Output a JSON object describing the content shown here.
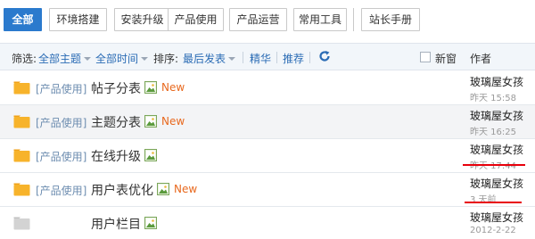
{
  "tabs": [
    {
      "label": "全部",
      "active": true
    },
    {
      "label": "环境搭建",
      "active": false
    },
    {
      "label": "安装升级",
      "active": false
    },
    {
      "label": "产品使用",
      "active": false
    },
    {
      "label": "产品运营",
      "active": false
    },
    {
      "label": "常用工具",
      "active": false
    },
    {
      "label": "站长手册",
      "active": false
    }
  ],
  "filter": {
    "filter_label": "筛选:",
    "topic_filter": "全部主题",
    "time_filter": "全部时间",
    "sort_label": "排序:",
    "sort_value": "最后发表",
    "digest": "精华",
    "recommend": "推荐",
    "new_window": "新窗",
    "author_header": "作者"
  },
  "threads": [
    {
      "prefix": "[产品使用]",
      "title": "帖子分表",
      "new": "New",
      "author": "玻璃屋女孩",
      "date": "昨天 15:58",
      "folder": "new",
      "underline": false
    },
    {
      "prefix": "[产品使用]",
      "title": "主题分表",
      "new": "New",
      "author": "玻璃屋女孩",
      "date": "昨天 16:25",
      "folder": "new",
      "underline": false
    },
    {
      "prefix": "[产品使用]",
      "title": "在线升级",
      "new": "",
      "author": "玻璃屋女孩",
      "date": "昨天 17:44",
      "folder": "new",
      "underline": true
    },
    {
      "prefix": "[产品使用]",
      "title": "用户表优化",
      "new": "New",
      "author": "玻璃屋女孩",
      "date": "3 天前",
      "folder": "new",
      "underline": true
    },
    {
      "prefix": "",
      "title": "用户栏目",
      "new": "",
      "author": "玻璃屋女孩",
      "date": "2012-2-22",
      "folder": "old",
      "underline": false
    }
  ],
  "colors": {
    "accent": "#2b7acd",
    "link": "#2b6cb5",
    "new": "#e8691f",
    "underline": "#e8000b"
  }
}
